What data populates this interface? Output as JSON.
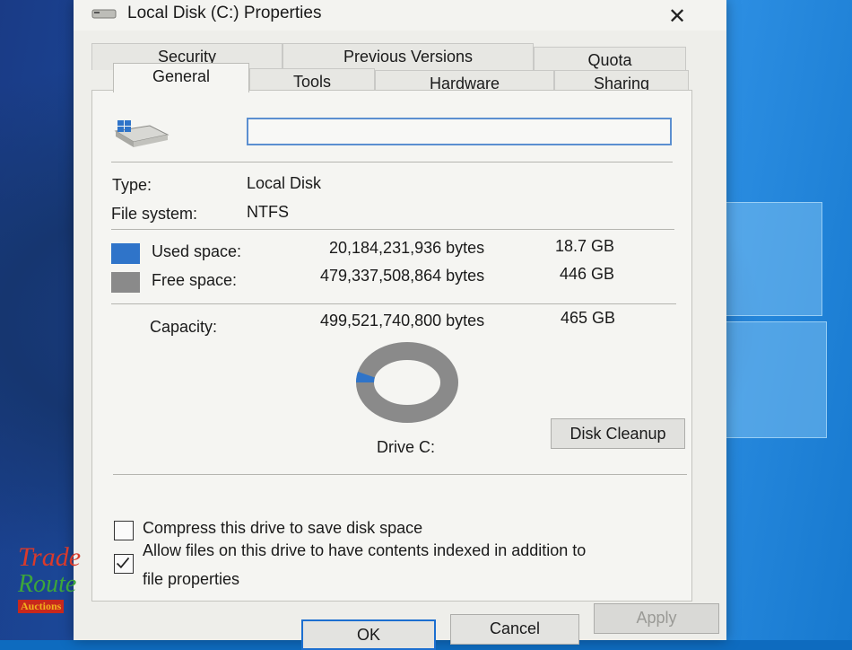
{
  "window": {
    "title": "Local Disk (C:) Properties",
    "close_label": "✕"
  },
  "tabs": {
    "row1": [
      "Security",
      "Previous Versions",
      "Quota"
    ],
    "row2": [
      "General",
      "Tools",
      "Hardware",
      "Sharing"
    ],
    "active": "General"
  },
  "general": {
    "drive_name_value": "",
    "type_label": "Type:",
    "type_value": "Local Disk",
    "fs_label": "File system:",
    "fs_value": "NTFS",
    "used_label": "Used space:",
    "used_bytes": "20,184,231,936 bytes",
    "used_size": "18.7 GB",
    "free_label": "Free space:",
    "free_bytes": "479,337,508,864 bytes",
    "free_size": "446 GB",
    "capacity_label": "Capacity:",
    "capacity_bytes": "499,521,740,800 bytes",
    "capacity_size": "465 GB",
    "used_fraction": 0.04,
    "drive_label": "Drive C:",
    "cleanup_label": "Disk Cleanup",
    "compress_label": "Compress this drive to save disk space",
    "compress_checked": false,
    "index_label_line1": "Allow files on this drive to have contents indexed in addition to",
    "index_label_line2": "file properties",
    "index_checked": true
  },
  "buttons": {
    "ok": "OK",
    "cancel": "Cancel",
    "apply": "Apply"
  },
  "watermark": {
    "line1": "Trade",
    "line2": "Route",
    "line3": "Auctions"
  },
  "colors": {
    "used": "#2f74c9",
    "free": "#8a8a8a",
    "accent": "#1c6fd0"
  }
}
